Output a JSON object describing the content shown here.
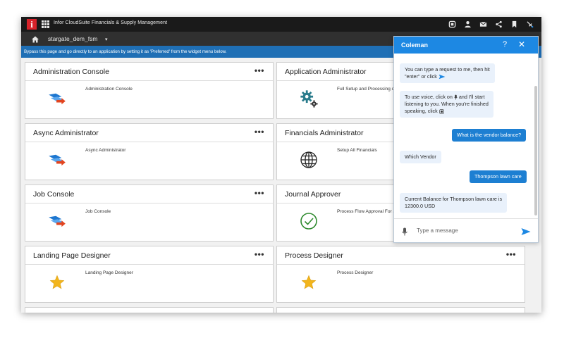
{
  "app": {
    "logo_letter": "i",
    "title": "Infor CloudSuite Financials & Supply Management"
  },
  "toolbar_icons": [
    "stop-icon",
    "user-icon",
    "mail-icon",
    "share-icon",
    "bookmark-icon",
    "pin-icon"
  ],
  "nav": {
    "tenant": "stargate_dem_fsm",
    "caret": "▾"
  },
  "banner": {
    "text": "Bypass this page and go directly to an application by setting it as 'Preferred' from the widget menu below."
  },
  "cards": [
    {
      "title": "Administration Console",
      "desc": "Administration Console",
      "icon": "arrow-icon",
      "more": "•••"
    },
    {
      "title": "Application Administrator",
      "desc": "Full Setup and Processing o",
      "icon": "gears-icon",
      "more": "•••"
    },
    {
      "title": "Async Administrator",
      "desc": "Async Administrator",
      "icon": "arrow-icon",
      "more": "•••"
    },
    {
      "title": "Financials Administrator",
      "desc": "Setup All Financials",
      "icon": "globe-icon",
      "more": "•••"
    },
    {
      "title": "Job Console",
      "desc": "Job Console",
      "icon": "arrow-icon",
      "more": "•••"
    },
    {
      "title": "Journal Approver",
      "desc": "Process Flow Approval For J",
      "icon": "checkmark-icon",
      "more": "•••"
    },
    {
      "title": "Landing Page Designer",
      "desc": "Landing Page Designer",
      "icon": "star-icon",
      "more": "•••"
    },
    {
      "title": "Process Designer",
      "desc": "Process Designer",
      "icon": "star-icon",
      "more": "•••"
    }
  ],
  "chat": {
    "agent_name": "Coleman",
    "help": "?",
    "close": "✕",
    "messages": [
      {
        "from": "bot",
        "lines": [
          "You can type a request to me, then hit",
          "\"enter\" or click"
        ]
      },
      {
        "from": "bot",
        "lines": [
          "To use voice, click on",
          "and I'll start",
          "listening to you. When you're finished",
          "speaking, click"
        ]
      },
      {
        "from": "user",
        "lines": [
          "What is the vendor balance?"
        ]
      },
      {
        "from": "bot",
        "lines": [
          "Which Vendor"
        ]
      },
      {
        "from": "user",
        "lines": [
          "Thompson lawn care"
        ]
      },
      {
        "from": "bot",
        "lines": [
          "Current Balance for Thompson lawn care is",
          "12300.0 USD"
        ]
      }
    ],
    "input_placeholder": "Type a message"
  },
  "colors": {
    "accent_blue": "#1d88e3",
    "banner_blue": "#1f6fb5",
    "logo_red": "#d6222a",
    "title_bar": "#1a1a1a"
  }
}
